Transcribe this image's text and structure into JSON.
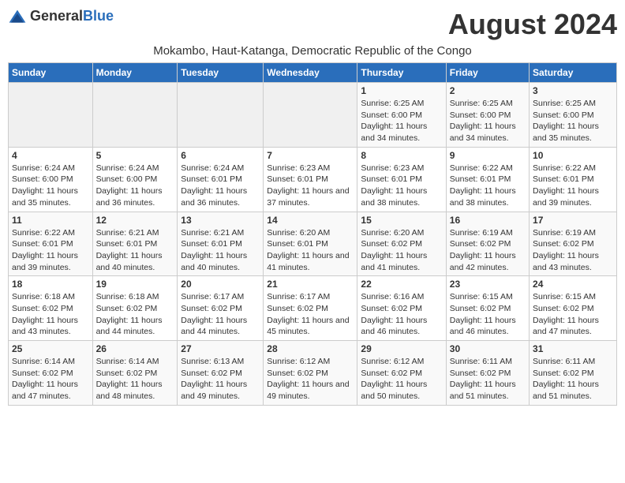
{
  "header": {
    "logo_general": "General",
    "logo_blue": "Blue",
    "month_title": "August 2024",
    "location": "Mokambo, Haut-Katanga, Democratic Republic of the Congo"
  },
  "days_of_week": [
    "Sunday",
    "Monday",
    "Tuesday",
    "Wednesday",
    "Thursday",
    "Friday",
    "Saturday"
  ],
  "weeks": [
    [
      {
        "day": "",
        "sunrise": "",
        "sunset": "",
        "daylight": ""
      },
      {
        "day": "",
        "sunrise": "",
        "sunset": "",
        "daylight": ""
      },
      {
        "day": "",
        "sunrise": "",
        "sunset": "",
        "daylight": ""
      },
      {
        "day": "",
        "sunrise": "",
        "sunset": "",
        "daylight": ""
      },
      {
        "day": "1",
        "sunrise": "6:25 AM",
        "sunset": "6:00 PM",
        "daylight": "11 hours and 34 minutes."
      },
      {
        "day": "2",
        "sunrise": "6:25 AM",
        "sunset": "6:00 PM",
        "daylight": "11 hours and 34 minutes."
      },
      {
        "day": "3",
        "sunrise": "6:25 AM",
        "sunset": "6:00 PM",
        "daylight": "11 hours and 35 minutes."
      }
    ],
    [
      {
        "day": "4",
        "sunrise": "6:24 AM",
        "sunset": "6:00 PM",
        "daylight": "11 hours and 35 minutes."
      },
      {
        "day": "5",
        "sunrise": "6:24 AM",
        "sunset": "6:00 PM",
        "daylight": "11 hours and 36 minutes."
      },
      {
        "day": "6",
        "sunrise": "6:24 AM",
        "sunset": "6:01 PM",
        "daylight": "11 hours and 36 minutes."
      },
      {
        "day": "7",
        "sunrise": "6:23 AM",
        "sunset": "6:01 PM",
        "daylight": "11 hours and 37 minutes."
      },
      {
        "day": "8",
        "sunrise": "6:23 AM",
        "sunset": "6:01 PM",
        "daylight": "11 hours and 38 minutes."
      },
      {
        "day": "9",
        "sunrise": "6:22 AM",
        "sunset": "6:01 PM",
        "daylight": "11 hours and 38 minutes."
      },
      {
        "day": "10",
        "sunrise": "6:22 AM",
        "sunset": "6:01 PM",
        "daylight": "11 hours and 39 minutes."
      }
    ],
    [
      {
        "day": "11",
        "sunrise": "6:22 AM",
        "sunset": "6:01 PM",
        "daylight": "11 hours and 39 minutes."
      },
      {
        "day": "12",
        "sunrise": "6:21 AM",
        "sunset": "6:01 PM",
        "daylight": "11 hours and 40 minutes."
      },
      {
        "day": "13",
        "sunrise": "6:21 AM",
        "sunset": "6:01 PM",
        "daylight": "11 hours and 40 minutes."
      },
      {
        "day": "14",
        "sunrise": "6:20 AM",
        "sunset": "6:01 PM",
        "daylight": "11 hours and 41 minutes."
      },
      {
        "day": "15",
        "sunrise": "6:20 AM",
        "sunset": "6:02 PM",
        "daylight": "11 hours and 41 minutes."
      },
      {
        "day": "16",
        "sunrise": "6:19 AM",
        "sunset": "6:02 PM",
        "daylight": "11 hours and 42 minutes."
      },
      {
        "day": "17",
        "sunrise": "6:19 AM",
        "sunset": "6:02 PM",
        "daylight": "11 hours and 43 minutes."
      }
    ],
    [
      {
        "day": "18",
        "sunrise": "6:18 AM",
        "sunset": "6:02 PM",
        "daylight": "11 hours and 43 minutes."
      },
      {
        "day": "19",
        "sunrise": "6:18 AM",
        "sunset": "6:02 PM",
        "daylight": "11 hours and 44 minutes."
      },
      {
        "day": "20",
        "sunrise": "6:17 AM",
        "sunset": "6:02 PM",
        "daylight": "11 hours and 44 minutes."
      },
      {
        "day": "21",
        "sunrise": "6:17 AM",
        "sunset": "6:02 PM",
        "daylight": "11 hours and 45 minutes."
      },
      {
        "day": "22",
        "sunrise": "6:16 AM",
        "sunset": "6:02 PM",
        "daylight": "11 hours and 46 minutes."
      },
      {
        "day": "23",
        "sunrise": "6:15 AM",
        "sunset": "6:02 PM",
        "daylight": "11 hours and 46 minutes."
      },
      {
        "day": "24",
        "sunrise": "6:15 AM",
        "sunset": "6:02 PM",
        "daylight": "11 hours and 47 minutes."
      }
    ],
    [
      {
        "day": "25",
        "sunrise": "6:14 AM",
        "sunset": "6:02 PM",
        "daylight": "11 hours and 47 minutes."
      },
      {
        "day": "26",
        "sunrise": "6:14 AM",
        "sunset": "6:02 PM",
        "daylight": "11 hours and 48 minutes."
      },
      {
        "day": "27",
        "sunrise": "6:13 AM",
        "sunset": "6:02 PM",
        "daylight": "11 hours and 49 minutes."
      },
      {
        "day": "28",
        "sunrise": "6:12 AM",
        "sunset": "6:02 PM",
        "daylight": "11 hours and 49 minutes."
      },
      {
        "day": "29",
        "sunrise": "6:12 AM",
        "sunset": "6:02 PM",
        "daylight": "11 hours and 50 minutes."
      },
      {
        "day": "30",
        "sunrise": "6:11 AM",
        "sunset": "6:02 PM",
        "daylight": "11 hours and 51 minutes."
      },
      {
        "day": "31",
        "sunrise": "6:11 AM",
        "sunset": "6:02 PM",
        "daylight": "11 hours and 51 minutes."
      }
    ]
  ],
  "labels": {
    "sunrise": "Sunrise:",
    "sunset": "Sunset:",
    "daylight": "Daylight:"
  }
}
